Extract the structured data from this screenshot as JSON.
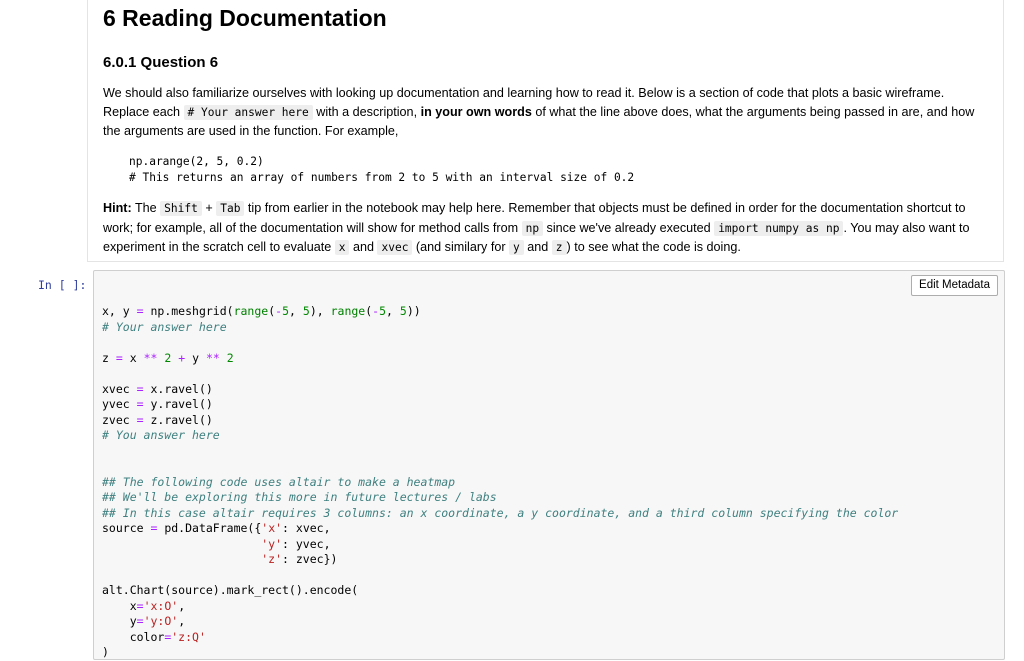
{
  "markdown": {
    "heading": "6 Reading Documentation",
    "subheading": "6.0.1 Question 6",
    "para1": {
      "t1": "We should also familiarize ourselves with looking up documentation and learning how to read it. Below is a section of code that plots a basic wireframe. Replace each ",
      "code1": "# Your answer here",
      "t2": " with a description, ",
      "bold1": "in your own words",
      "t3": " of what the line above does, what the arguments being passed in are, and how the arguments are used in the function. For example,"
    },
    "example": {
      "line1": "np.arange(2, 5, 0.2)",
      "line2": "# This returns an array of numbers from 2 to 5 with an interval size of 0.2"
    },
    "para2": {
      "hint": "Hint:",
      "t1": " The ",
      "code_shift": "Shift",
      "t2": " + ",
      "code_tab": "Tab",
      "t3": " tip from earlier in the notebook may help here. Remember that objects must be defined in order for the documentation shortcut to work; for example, all of the documentation will show for method calls from ",
      "code_np": "np",
      "t4": " since we've already executed ",
      "code_import": "import numpy as np",
      "t5": ". You may also want to experiment in the scratch cell to evaluate ",
      "code_x": "x",
      "t6": " and ",
      "code_xvec": "xvec",
      "t7": " (and similary for ",
      "code_y": "y",
      "t8": " and ",
      "code_z": "z",
      "t9": ") to see what the code is doing."
    }
  },
  "code_cell": {
    "prompt": "In [ ]:",
    "edit_metadata_label": "Edit Metadata"
  },
  "colors": {
    "prompt": "#303f9f",
    "comment": "#408080",
    "string": "#ba2121",
    "number": "#008800",
    "builtin": "#008000",
    "operator": "#aa22ff"
  }
}
